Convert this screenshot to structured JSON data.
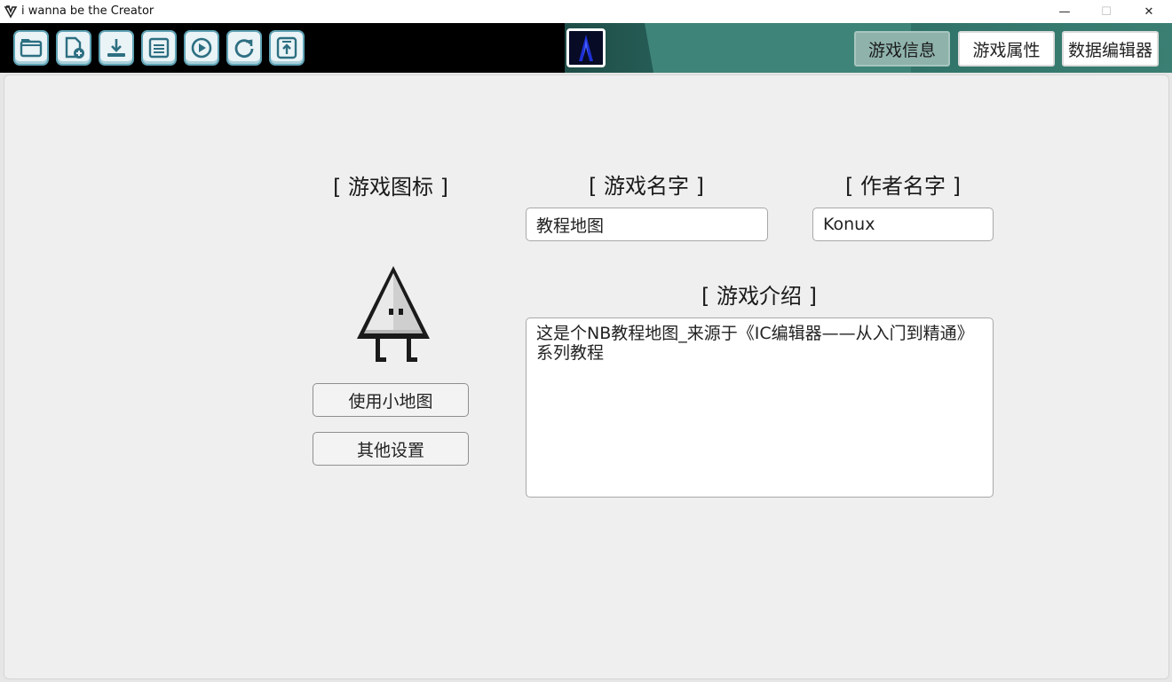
{
  "window": {
    "title": "i wanna be the Creator",
    "minimize_glyph": "—",
    "maximize_glyph": "☐",
    "close_glyph": "✕"
  },
  "toolbar": {
    "tools": [
      {
        "name": "open-folder-icon"
      },
      {
        "name": "new-file-icon"
      },
      {
        "name": "download-icon"
      },
      {
        "name": "save-icon"
      },
      {
        "name": "play-icon"
      },
      {
        "name": "refresh-icon"
      },
      {
        "name": "upload-icon"
      }
    ],
    "tabs": {
      "game_info": "游戏信息",
      "game_properties": "游戏属性",
      "data_editor": "数据编辑器"
    },
    "active_tab": "game_info",
    "colors": {
      "background": "#000000",
      "banner": "#2a6b62",
      "tool_button_border": "#5fa3b5",
      "active_tab": "#8fb3ab"
    }
  },
  "game_info": {
    "icon_title": "[ 游戏图标 ]",
    "name_title": "[ 游戏名字 ]",
    "author_title": "[ 作者名字 ]",
    "intro_title": "[ 游戏介绍 ]",
    "game_name": "教程地图",
    "author_name": "Konux",
    "intro_text": "这是个NB教程地图_来源于《IC编辑器——从入门到精通》\n系列教程",
    "use_minimap_button": "使用小地图",
    "other_settings_button": "其他设置"
  }
}
